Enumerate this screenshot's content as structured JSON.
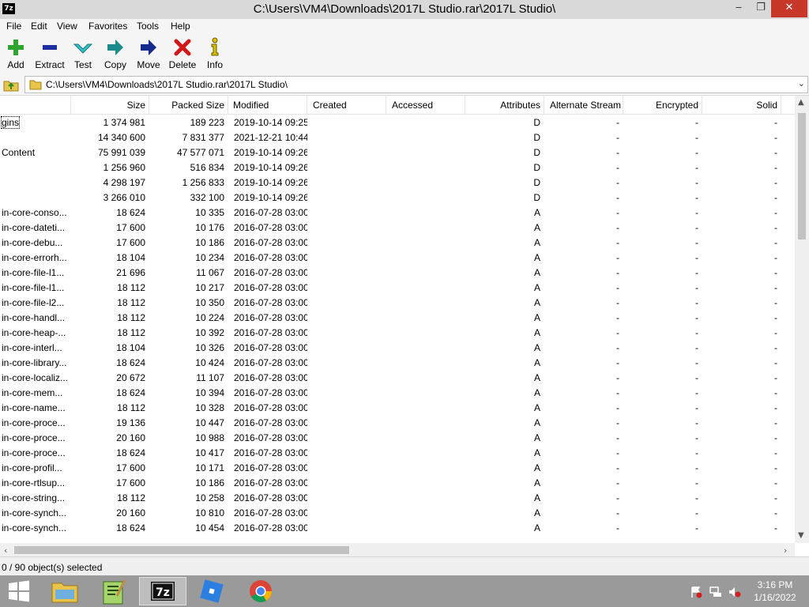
{
  "window": {
    "app_icon_text": "7z",
    "title": "C:\\Users\\VM4\\Downloads\\2017L Studio.rar\\2017L Studio\\",
    "min_glyph": "‒",
    "max_glyph": "❐",
    "close_glyph": "✕"
  },
  "menu": [
    "File",
    "Edit",
    "View",
    "Favorites",
    "Tools",
    "Help"
  ],
  "toolbar": {
    "add": "Add",
    "extract": "Extract",
    "test": "Test",
    "copy": "Copy",
    "move": "Move",
    "delete": "Delete",
    "info": "Info"
  },
  "address": {
    "path": "C:\\Users\\VM4\\Downloads\\2017L Studio.rar\\2017L Studio\\",
    "dropdown_glyph": "⌄"
  },
  "columns": {
    "size": "Size",
    "packed": "Packed Size",
    "modified": "Modified",
    "created": "Created",
    "accessed": "Accessed",
    "attributes": "Attributes",
    "alt_stream": "Alternate Stream",
    "encrypted": "Encrypted",
    "solid": "Solid"
  },
  "rows": [
    {
      "name": "gins",
      "size": "1 374 981",
      "packed": "189 223",
      "modified": "2019-10-14 09:25",
      "attr": "D",
      "alt": "-",
      "enc": "-",
      "solid": "-"
    },
    {
      "name": "",
      "size": "14 340 600",
      "packed": "7 831 377",
      "modified": "2021-12-21 10:44",
      "attr": "D",
      "alt": "-",
      "enc": "-",
      "solid": "-"
    },
    {
      "name": "Content",
      "size": "75 991 039",
      "packed": "47 577 071",
      "modified": "2019-10-14 09:26",
      "attr": "D",
      "alt": "-",
      "enc": "-",
      "solid": "-"
    },
    {
      "name": "",
      "size": "1 256 960",
      "packed": "516 834",
      "modified": "2019-10-14 09:26",
      "attr": "D",
      "alt": "-",
      "enc": "-",
      "solid": "-"
    },
    {
      "name": "",
      "size": "4 298 197",
      "packed": "1 256 833",
      "modified": "2019-10-14 09:26",
      "attr": "D",
      "alt": "-",
      "enc": "-",
      "solid": "-"
    },
    {
      "name": "",
      "size": "3 266 010",
      "packed": "332 100",
      "modified": "2019-10-14 09:26",
      "attr": "D",
      "alt": "-",
      "enc": "-",
      "solid": "-"
    },
    {
      "name": "in-core-conso...",
      "size": "18 624",
      "packed": "10 335",
      "modified": "2016-07-28 03:00",
      "attr": "A",
      "alt": "-",
      "enc": "-",
      "solid": "-"
    },
    {
      "name": "in-core-dateti...",
      "size": "17 600",
      "packed": "10 176",
      "modified": "2016-07-28 03:00",
      "attr": "A",
      "alt": "-",
      "enc": "-",
      "solid": "-"
    },
    {
      "name": "in-core-debu...",
      "size": "17 600",
      "packed": "10 186",
      "modified": "2016-07-28 03:00",
      "attr": "A",
      "alt": "-",
      "enc": "-",
      "solid": "-"
    },
    {
      "name": "in-core-errorh...",
      "size": "18 104",
      "packed": "10 234",
      "modified": "2016-07-28 03:00",
      "attr": "A",
      "alt": "-",
      "enc": "-",
      "solid": "-"
    },
    {
      "name": "in-core-file-l1...",
      "size": "21 696",
      "packed": "11 067",
      "modified": "2016-07-28 03:00",
      "attr": "A",
      "alt": "-",
      "enc": "-",
      "solid": "-"
    },
    {
      "name": "in-core-file-l1...",
      "size": "18 112",
      "packed": "10 217",
      "modified": "2016-07-28 03:00",
      "attr": "A",
      "alt": "-",
      "enc": "-",
      "solid": "-"
    },
    {
      "name": "in-core-file-l2...",
      "size": "18 112",
      "packed": "10 350",
      "modified": "2016-07-28 03:00",
      "attr": "A",
      "alt": "-",
      "enc": "-",
      "solid": "-"
    },
    {
      "name": "in-core-handl...",
      "size": "18 112",
      "packed": "10 224",
      "modified": "2016-07-28 03:00",
      "attr": "A",
      "alt": "-",
      "enc": "-",
      "solid": "-"
    },
    {
      "name": "in-core-heap-...",
      "size": "18 112",
      "packed": "10 392",
      "modified": "2016-07-28 03:00",
      "attr": "A",
      "alt": "-",
      "enc": "-",
      "solid": "-"
    },
    {
      "name": "in-core-interl...",
      "size": "18 104",
      "packed": "10 326",
      "modified": "2016-07-28 03:00",
      "attr": "A",
      "alt": "-",
      "enc": "-",
      "solid": "-"
    },
    {
      "name": "in-core-library...",
      "size": "18 624",
      "packed": "10 424",
      "modified": "2016-07-28 03:00",
      "attr": "A",
      "alt": "-",
      "enc": "-",
      "solid": "-"
    },
    {
      "name": "in-core-localiz...",
      "size": "20 672",
      "packed": "11 107",
      "modified": "2016-07-28 03:00",
      "attr": "A",
      "alt": "-",
      "enc": "-",
      "solid": "-"
    },
    {
      "name": "in-core-mem...",
      "size": "18 624",
      "packed": "10 394",
      "modified": "2016-07-28 03:00",
      "attr": "A",
      "alt": "-",
      "enc": "-",
      "solid": "-"
    },
    {
      "name": "in-core-name...",
      "size": "18 112",
      "packed": "10 328",
      "modified": "2016-07-28 03:00",
      "attr": "A",
      "alt": "-",
      "enc": "-",
      "solid": "-"
    },
    {
      "name": "in-core-proce...",
      "size": "19 136",
      "packed": "10 447",
      "modified": "2016-07-28 03:00",
      "attr": "A",
      "alt": "-",
      "enc": "-",
      "solid": "-"
    },
    {
      "name": "in-core-proce...",
      "size": "20 160",
      "packed": "10 988",
      "modified": "2016-07-28 03:00",
      "attr": "A",
      "alt": "-",
      "enc": "-",
      "solid": "-"
    },
    {
      "name": "in-core-proce...",
      "size": "18 624",
      "packed": "10 417",
      "modified": "2016-07-28 03:00",
      "attr": "A",
      "alt": "-",
      "enc": "-",
      "solid": "-"
    },
    {
      "name": "in-core-profil...",
      "size": "17 600",
      "packed": "10 171",
      "modified": "2016-07-28 03:00",
      "attr": "A",
      "alt": "-",
      "enc": "-",
      "solid": "-"
    },
    {
      "name": "in-core-rtlsup...",
      "size": "17 600",
      "packed": "10 186",
      "modified": "2016-07-28 03:00",
      "attr": "A",
      "alt": "-",
      "enc": "-",
      "solid": "-"
    },
    {
      "name": "in-core-string...",
      "size": "18 112",
      "packed": "10 258",
      "modified": "2016-07-28 03:00",
      "attr": "A",
      "alt": "-",
      "enc": "-",
      "solid": "-"
    },
    {
      "name": "in-core-synch...",
      "size": "20 160",
      "packed": "10 810",
      "modified": "2016-07-28 03:00",
      "attr": "A",
      "alt": "-",
      "enc": "-",
      "solid": "-"
    },
    {
      "name": "in-core-synch...",
      "size": "18 624",
      "packed": "10 454",
      "modified": "2016-07-28 03:00",
      "attr": "A",
      "alt": "-",
      "enc": "-",
      "solid": "-"
    }
  ],
  "status": "0 / 90 object(s) selected",
  "clock": {
    "time": "3:16 PM",
    "date": "1/16/2022"
  },
  "taskbar_apps": [
    "file-explorer-icon",
    "notepad-plus-icon",
    "7zip-icon",
    "roblox-icon",
    "chrome-icon"
  ],
  "colors": {
    "titlebar": "#d9d9d9",
    "close": "#c7372a",
    "taskbar": "#9a9a9a",
    "add_icon": "#2fa52f",
    "extract_icon": "#1b2fa0",
    "test_icon": "#33c0c8",
    "copy_icon": "#1a8a8a",
    "move_icon": "#142a8c",
    "delete_icon": "#d01818",
    "info_icon": "#d8c000"
  }
}
